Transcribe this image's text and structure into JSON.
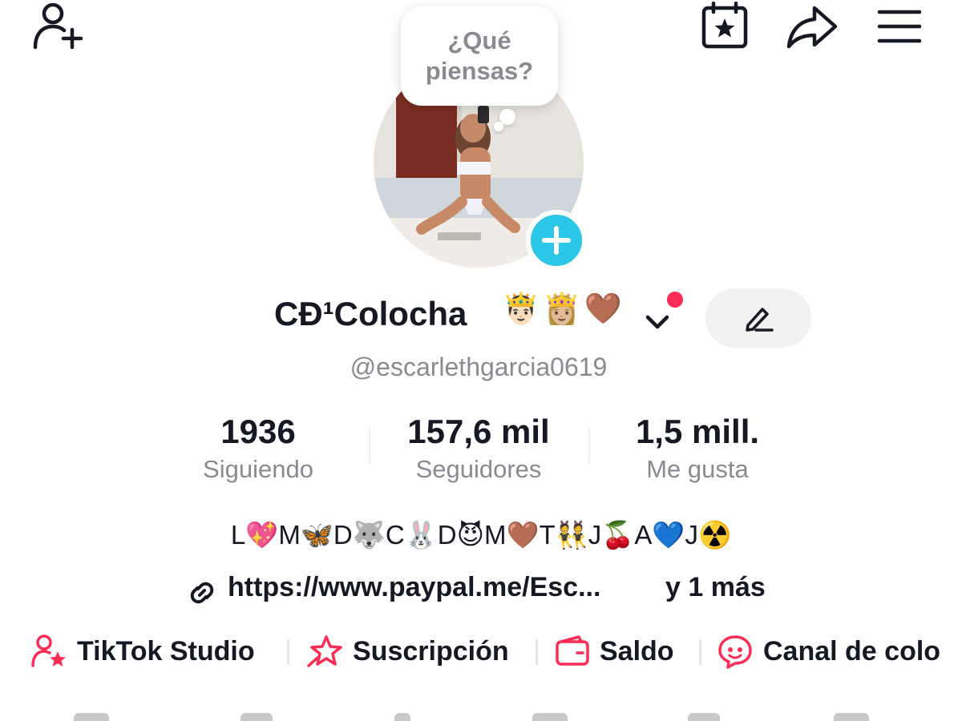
{
  "header": {
    "left_icon": "add-friend-icon",
    "right_icons": [
      "calendar-star-icon",
      "share-icon",
      "menu-icon"
    ]
  },
  "profile": {
    "thought_bubble": "¿Qué piensas?",
    "avatar_description_icon": "profile-photo",
    "add_icon": "plus-icon",
    "display_name": "CĐ¹Colocha",
    "name_emojis": "🤴🏻👸🏼🤎",
    "handle": "@escarlethgarcia0619",
    "edit_icon": "pencil-icon"
  },
  "stats": [
    {
      "value": "1936",
      "label": "Siguiendo"
    },
    {
      "value": "157,6 mil",
      "label": "Seguidores"
    },
    {
      "value": "1,5 mill.",
      "label": "Me gusta"
    }
  ],
  "bio": "L💖M🦋D🐺C🐰D😈M🤎T👯J🍒A💙J☢️",
  "link": {
    "url": "https://www.paypal.me/Esc...",
    "more": "y 1 más"
  },
  "tools": [
    {
      "label": "TikTok Studio",
      "icon": "studio-icon"
    },
    {
      "label": "Suscripción",
      "icon": "subscription-star-icon"
    },
    {
      "label": "Saldo",
      "icon": "wallet-icon"
    },
    {
      "label": "Canal de colo",
      "icon": "chat-channel-icon"
    }
  ],
  "colors": {
    "accent_red": "#fe2c55",
    "add_blue": "#2ac7e6",
    "secondary_text": "#8a8b91",
    "primary_text": "#161823"
  }
}
